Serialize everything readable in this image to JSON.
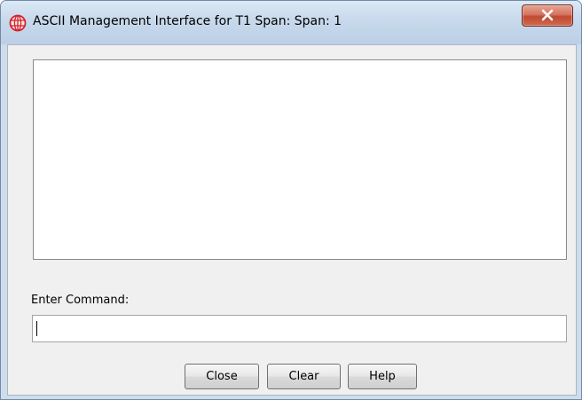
{
  "window": {
    "title": "ASCII Management Interface for T1 Span: Span: 1",
    "app_icon": "globe-grid-icon",
    "close_icon": "close-icon",
    "accent_close": "#c8513a"
  },
  "main": {
    "output_text": "",
    "command_label": "Enter Command:",
    "command_value": ""
  },
  "buttons": {
    "close_label": "Close",
    "clear_label": "Clear",
    "help_label": "Help"
  }
}
